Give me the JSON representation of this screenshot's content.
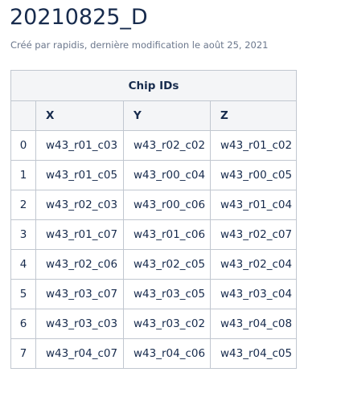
{
  "page": {
    "title": "20210825_D",
    "meta": "Créé par rapidis, dernière modification le août 25, 2021"
  },
  "table": {
    "group_header": "Chip IDs",
    "columns": [
      "X",
      "Y",
      "Z"
    ],
    "rows": [
      {
        "index": "0",
        "x": "w43_r01_c03",
        "y": "w43_r02_c02",
        "z": "w43_r01_c02"
      },
      {
        "index": "1",
        "x": "w43_r01_c05",
        "y": "w43_r00_c04",
        "z": "w43_r00_c05"
      },
      {
        "index": "2",
        "x": "w43_r02_c03",
        "y": "w43_r00_c06",
        "z": "w43_r01_c04"
      },
      {
        "index": "3",
        "x": "w43_r01_c07",
        "y": "w43_r01_c06",
        "z": "w43_r02_c07"
      },
      {
        "index": "4",
        "x": "w43_r02_c06",
        "y": "w43_r02_c05",
        "z": "w43_r02_c04"
      },
      {
        "index": "5",
        "x": "w43_r03_c07",
        "y": "w43_r03_c05",
        "z": "w43_r03_c04"
      },
      {
        "index": "6",
        "x": "w43_r03_c03",
        "y": "w43_r03_c02",
        "z": "w43_r04_c08"
      },
      {
        "index": "7",
        "x": "w43_r04_c07",
        "y": "w43_r04_c06",
        "z": "w43_r04_c05"
      }
    ]
  }
}
